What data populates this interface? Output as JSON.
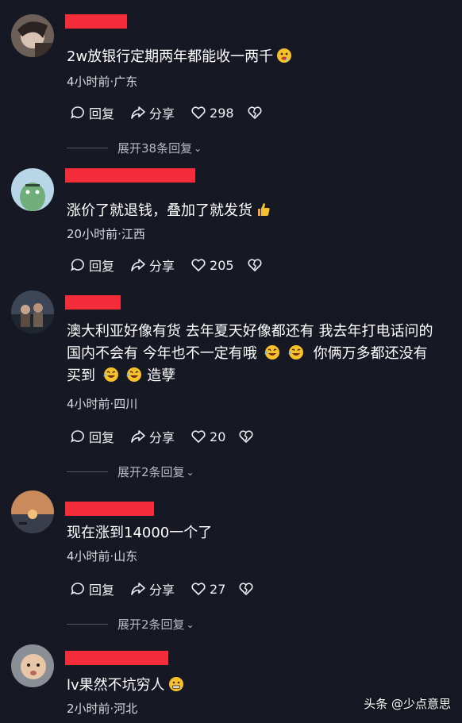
{
  "comments": [
    {
      "text": "2w放银行定期两年都能收一两千",
      "meta": "4小时前·广东",
      "reply_label": "回复",
      "share_label": "分享",
      "likes": "298",
      "expand": "展开38条回复",
      "emoji": "drooling-face"
    },
    {
      "text": "涨价了就退钱，叠加了就发货",
      "meta": "20小时前·江西",
      "reply_label": "回复",
      "share_label": "分享",
      "likes": "205",
      "emoji": "thumbs-up"
    },
    {
      "text_line1": "澳大利亚好像有货 去年夏天好像都还有 我去年打电话问的",
      "text_line2a": "国内不会有 今年也不一定有哦",
      "text_line2b": "你俩万多都还没有",
      "text_line3a": "买到",
      "text_line3b": "造孽",
      "meta": "4小时前·四川",
      "reply_label": "回复",
      "share_label": "分享",
      "likes": "20",
      "expand": "展开2条回复"
    },
    {
      "text": "现在涨到14000一个了",
      "meta": "4小时前·山东",
      "reply_label": "回复",
      "share_label": "分享",
      "likes": "27",
      "expand": "展开2条回复"
    },
    {
      "text": "lv果然不坑穷人",
      "meta": "2小时前·河北",
      "emoji": "grimace-face"
    }
  ],
  "watermark": "头条 @少点意思",
  "colors": {
    "background": "#161823",
    "redaction": "#f52c3a",
    "text": "#ffffff",
    "meta": "#d9d9de"
  }
}
